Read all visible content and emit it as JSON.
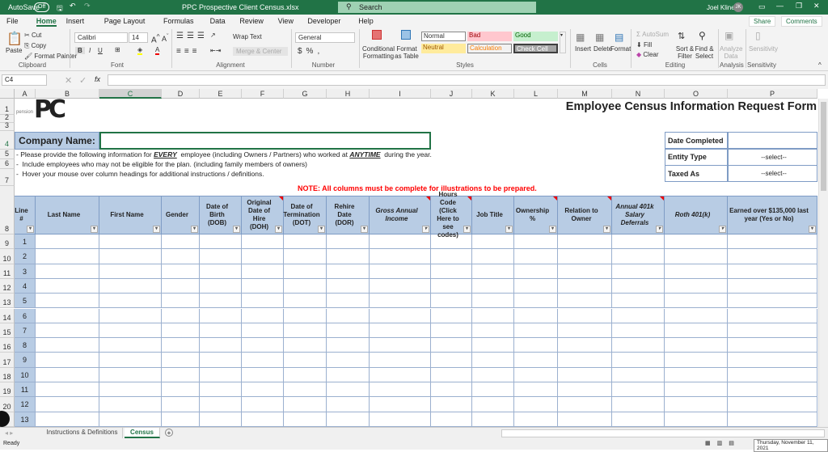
{
  "titlebar": {
    "autosave": "AutoSave",
    "autosave_state": "Off",
    "filename": "PPC Prospective Client Census.xlsx",
    "search": "Search",
    "user": "Joel Kline",
    "initials": "JK"
  },
  "menu": [
    "File",
    "Home",
    "Insert",
    "Page Layout",
    "Formulas",
    "Data",
    "Review",
    "View",
    "Developer",
    "Help"
  ],
  "share": "Share",
  "comments": "Comments",
  "ribbon": {
    "clipboard": {
      "paste": "Paste",
      "cut": "Cut",
      "copy": "Copy",
      "format_painter": "Format Painter",
      "label": "Clipboard"
    },
    "font": {
      "name": "Calibri",
      "size": "14",
      "label": "Font"
    },
    "alignment": {
      "wrap": "Wrap Text",
      "merge": "Merge & Center",
      "label": "Alignment"
    },
    "number": {
      "format": "General",
      "label": "Number"
    },
    "styles": {
      "conditional": "Conditional Formatting",
      "format_table": "Format as Table",
      "normal": "Normal",
      "bad": "Bad",
      "good": "Good",
      "neutral": "Neutral",
      "calculation": "Calculation",
      "check": "Check Cell",
      "label": "Styles"
    },
    "cells": {
      "insert": "Insert",
      "delete": "Delete",
      "format": "Format",
      "label": "Cells"
    },
    "editing": {
      "autosum": "AutoSum",
      "fill": "Fill",
      "clear": "Clear",
      "sort": "Sort & Filter",
      "find": "Find & Select",
      "label": "Editing"
    },
    "analysis": {
      "analyze": "Analyze Data",
      "label": "Analysis"
    },
    "sensitivity": {
      "button": "Sensitivity",
      "label": "Sensitivity"
    }
  },
  "formula_bar": {
    "name_box": "C4",
    "fx": "fx",
    "value": ""
  },
  "columns": [
    "A",
    "B",
    "C",
    "D",
    "E",
    "F",
    "G",
    "H",
    "I",
    "J",
    "K",
    "L",
    "M",
    "N",
    "O",
    "P"
  ],
  "rows": [
    "1",
    "2",
    "3",
    "4",
    "5",
    "6",
    "7",
    "8",
    "9",
    "10",
    "11",
    "12",
    "13",
    "14",
    "15",
    "16",
    "17",
    "18",
    "19",
    "20",
    ""
  ],
  "logo": {
    "text": "PC",
    "sub1": "pension",
    "sub2": "planning",
    "sub3": "consultants"
  },
  "sheet": {
    "title": "Employee Census Information Request Form",
    "company_label": "Company Name:",
    "company_value": "",
    "info": [
      "- Please provide the following information for EVERY  employee (including Owners / Partners) who worked at ANYTIME  during the year.",
      "-  Include employees who may not be eligible for the plan. (including family members of owners)",
      "-  Hover your mouse over column headings for additional instructions / definitions."
    ],
    "note": "NOTE:  All columns must be complete for illustrations to be prepared.",
    "right_box": [
      {
        "label": "Date Completed",
        "value": ""
      },
      {
        "label": "Entity Type",
        "value": "--select--"
      },
      {
        "label": "Taxed As",
        "value": "--select--"
      }
    ],
    "headers": [
      "Line #",
      "Last Name",
      "First Name",
      "Gender",
      "Date of Birth (DOB)",
      "Original Date of Hire (DOH)",
      "Date of Termination (DOT)",
      "Rehire Date (DOR)",
      "Gross Annual Income",
      "Hours Code (Click Here to see codes)",
      "Job Title",
      "Ownership %",
      "Relation to Owner",
      "Annual 401k Salary Deferrals",
      "Roth 401(k)",
      "Earned over $135,000 last year (Yes or No)"
    ],
    "line_numbers": [
      "1",
      "2",
      "3",
      "4",
      "5",
      "6",
      "7",
      "8",
      "9",
      "10",
      "11",
      "12",
      "13"
    ]
  },
  "tabs": [
    {
      "label": "Instructions & Definitions",
      "active": false
    },
    {
      "label": "Census",
      "active": true
    }
  ],
  "status": {
    "ready": "Ready",
    "date": "Thursday, November 11, 2021"
  },
  "colors": {
    "excel_green": "#217346",
    "header_fill": "#b8cce4",
    "note_red": "#ff0000"
  }
}
